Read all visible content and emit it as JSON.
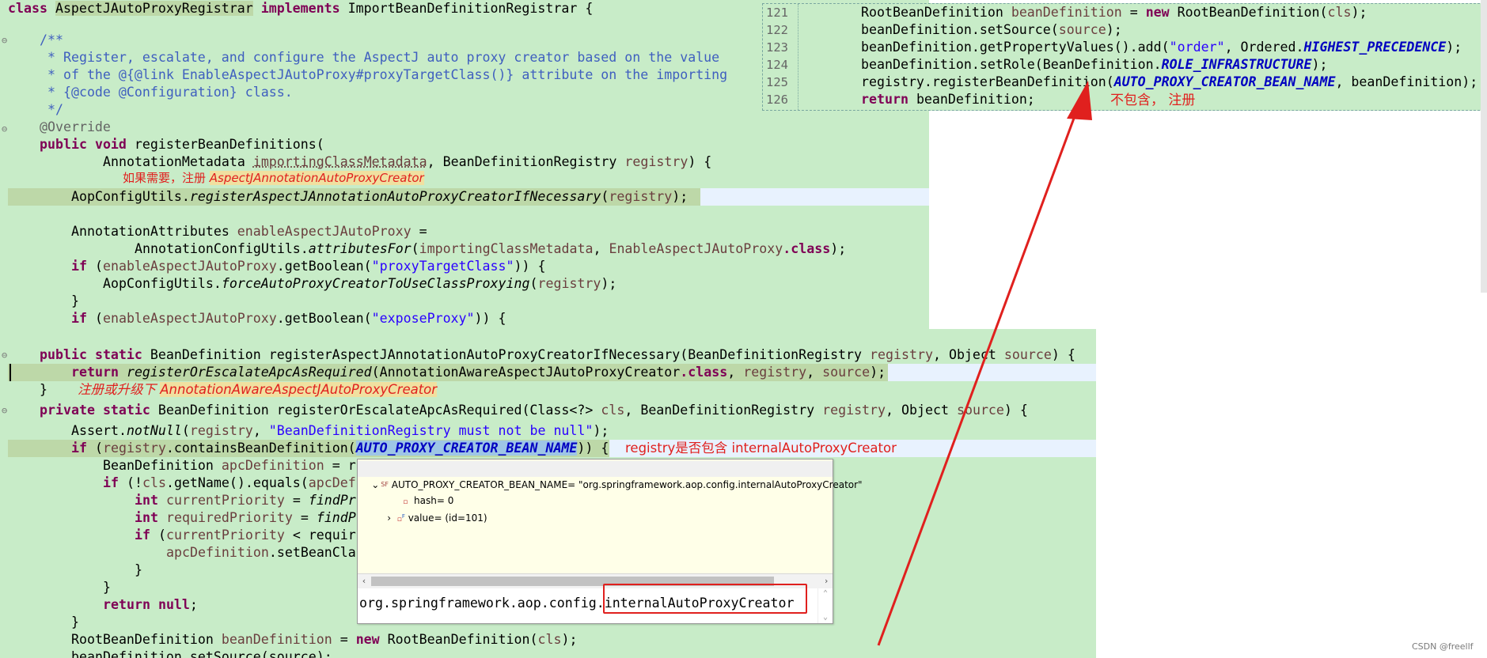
{
  "code": {
    "line_class": "class AspectJAutoProxyRegistrar implements ImportBeanDefinitionRegistrar {",
    "doc1": "/**",
    "doc2": " * Register, escalate, and configure the AspectJ auto proxy creator based on the value",
    "doc3": " * of the @{@link EnableAspectJAutoProxy#proxyTargetClass()} attribute on the importing",
    "doc4": " * {@code @Configuration} class.",
    "doc5": " */",
    "override": "@Override",
    "reg_sig1": "public void registerBeanDefinitions(",
    "reg_sig2_type": "AnnotationMetadata ",
    "reg_sig2_var1": "importingClassMetadata",
    "reg_sig2_mid": ", BeanDefinitionRegistry ",
    "reg_sig2_var2": "registry",
    "reg_sig2_end": ") {",
    "aop_call_cls": "AopConfigUtils.",
    "aop_call_m": "registerAspectJAnnotationAutoProxyCreatorIfNecessary",
    "aop_call_arg": "registry",
    "aop_call_end": ");",
    "attrs1_type": "AnnotationAttributes ",
    "attrs1_var": "enableAspectJAutoProxy",
    "attrs1_end": " =",
    "attrs2_cls": "AnnotationConfigUtils.",
    "attrs2_m": "attributesFor",
    "attrs2_a1": "importingClassMetadata",
    "attrs2_mid": ", ",
    "attrs2_a2": "EnableAspectJAutoProxy",
    "attrs2_class": ".class",
    "attrs2_end": ");",
    "if1_var": "enableAspectJAutoProxy",
    "if1_m": ".getBoolean(",
    "if1_str": "\"proxyTargetClass\"",
    "if1_end": ")) {",
    "force_cls": "AopConfigUtils.",
    "force_m": "forceAutoProxyCreatorToUseClassProxying",
    "force_arg": "registry",
    "force_end": ");",
    "brace": "}",
    "if2_str": "\"exposeProxy\"",
    "m2_sig": "BeanDefinition registerAspectJAnnotationAutoProxyCreatorIfNecessary(BeanDefinitionRegistry ",
    "m2_mid": ", Object ",
    "m2_src": "source",
    "m2_end": ") {",
    "ret_m": "registerOrEscalateApcAsRequired",
    "ret_a1": "(AnnotationAwareAspectJAutoProxyCreator",
    "ret_sep": ", ",
    "ret_end": ");",
    "m3_sig": "BeanDefinition registerOrEscalateApcAsRequired(Class<?> ",
    "m3_cls": "cls",
    "m3_mid": ", BeanDefinitionRegistry ",
    "assert_cls": "Assert.",
    "assert_m": "notNull",
    "assert_str": "\"BeanDefinitionRegistry must not be null\"",
    "contains_m": ".containsBeanDefinition(",
    "contains_c": "AUTO_PROXY_CREATOR_BEAN_NAME",
    "contains_end": ")) {",
    "apc_type": "BeanDefinition ",
    "apc_var": "apcDefinition",
    "apc_end": " = r",
    "if3_a": "(!",
    "if3_b": ".getName().equals(",
    "if3_c": "apcDef",
    "int_kw": "int",
    "cur_var": "currentPriority",
    "cur_end": " = ",
    "find_m": "findPr",
    "req_var": "requiredPriority",
    "req_m": "findP",
    "if4_a": "(",
    "if4_b": " < requir",
    "set_var": "apcDefinition",
    "set_end": ".setBeanCla",
    "return_kw": "return",
    "null_kw": "null",
    "semi": ";",
    "root_type": "RootBeanDefinition ",
    "root_var": "beanDefinition",
    "root_mid": " = ",
    "new_kw": "new",
    "root_end": " RootBeanDefinition(",
    "root_end2": ");",
    "last_partial": "beanDefinition.setSource(source);",
    "kw_class": "class",
    "kw_implements": "implements",
    "kw_public": "public",
    "kw_static": "static",
    "kw_private": "private",
    "kw_void": "void",
    "kw_if": "if",
    "kw_return": "return",
    "kw_new": "new",
    "kw_null": "null"
  },
  "snippet": {
    "line_numbers": [
      "121",
      "122",
      "123",
      "124",
      "125",
      "126"
    ],
    "l1a": "RootBeanDefinition ",
    "l1b": "beanDefinition",
    "l1c": " = ",
    "l1d": "new",
    "l1e": " RootBeanDefinition(",
    "l1f": "cls",
    "l1g": ");",
    "l2a": "beanDefinition.setSource(",
    "l2b": "source",
    "l2c": ");",
    "l3a": "beanDefinition.getPropertyValues().add(",
    "l3b": "\"order\"",
    "l3c": ", Ordered.",
    "l3d": "HIGHEST_PRECEDENCE",
    "l3e": ");",
    "l4a": "beanDefinition.setRole(BeanDefinition.",
    "l4b": "ROLE_INFRASTRUCTURE",
    "l4c": ");",
    "l5a": "registry.registerBeanDefinition(",
    "l5b": "AUTO_PROXY_CREATOR_BEAN_NAME",
    "l5c": ", beanDefinition);",
    "l6a": "return",
    "l6b": " beanDefinition;"
  },
  "annotations": {
    "note1_prefix": "如果需要，注册 ",
    "note1_cls": "AspectJAnnotationAutoProxyCreator",
    "note2_prefix": "注册或升级下 ",
    "note2_cls": "AnnotationAwareAspectJAutoProxyCreator",
    "note3": "registry是否包含 internalAutoProxyCreator",
    "note4": "不包含，  注册"
  },
  "popup": {
    "root_label": "AUTO_PROXY_CREATOR_BEAN_NAME= \"org.springframework.aop.config.internalAutoProxyCreator\"",
    "root_badge": "SF",
    "child1": "hash= 0",
    "child2_badge": "F",
    "child2": "value= (id=101)",
    "detail_prefix": "org.springframework.aop.config.",
    "detail_highlight": "internalAutoProxyCreator"
  },
  "watermark": "CSDN @freellf",
  "colors": {
    "editor_bg": "#c8ecc8",
    "current_line": "#e8f2fe",
    "annotation_red": "#e0201e",
    "popup_bg": "#ffffe8"
  }
}
